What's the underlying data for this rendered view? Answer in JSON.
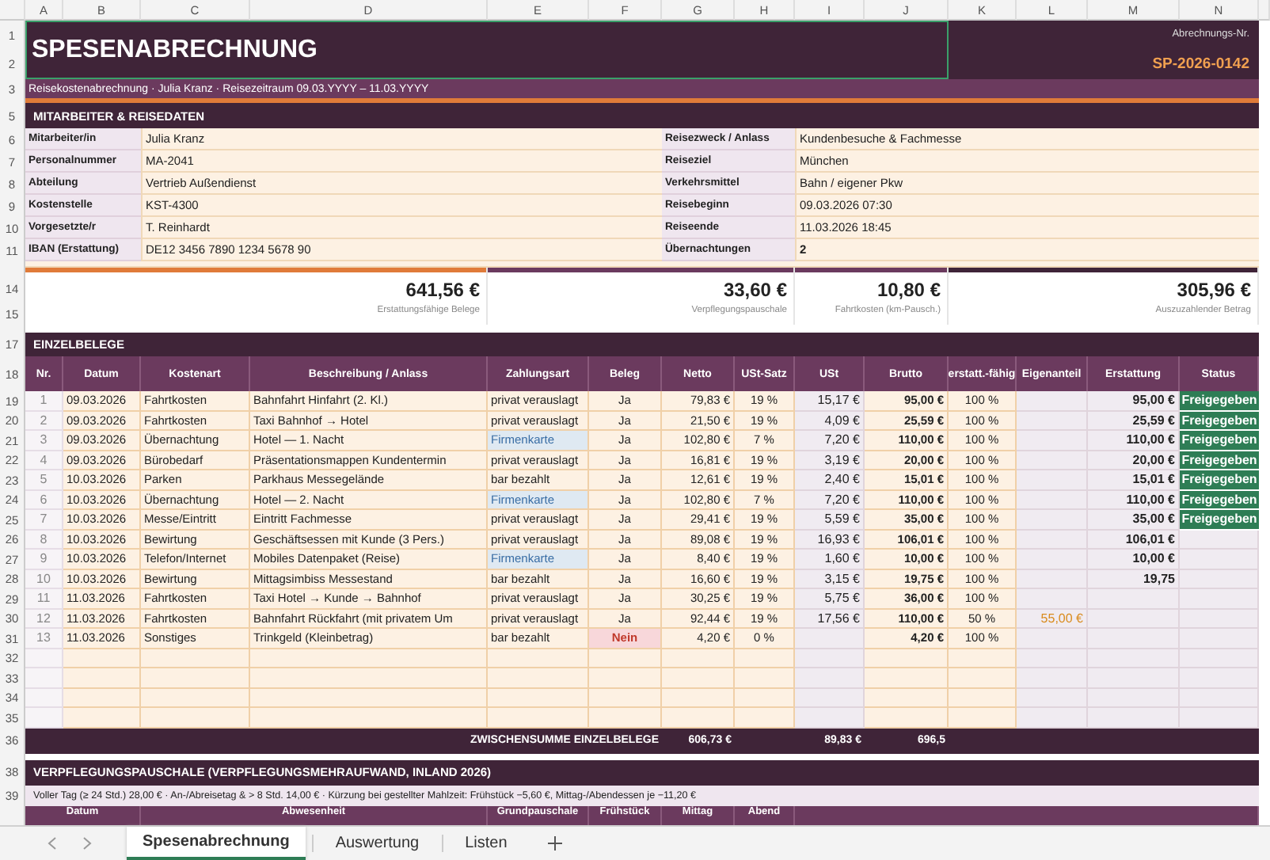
{
  "column_headers": [
    "A",
    "B",
    "C",
    "D",
    "E",
    "F",
    "G",
    "H",
    "I",
    "J",
    "K",
    "L",
    "M",
    "N"
  ],
  "row_numbers": [
    "1",
    "2",
    "3",
    "5",
    "6",
    "7",
    "8",
    "9",
    "10",
    "11",
    "14",
    "15",
    "17",
    "18",
    "19",
    "20",
    "21",
    "22",
    "23",
    "24",
    "25",
    "26",
    "27",
    "28",
    "29",
    "30",
    "31",
    "32",
    "33",
    "34",
    "35",
    "36",
    "38",
    "39"
  ],
  "title": {
    "text": "SPESENABRECHNUNG",
    "selected": true,
    "number_label": "Abrechnungs-Nr.",
    "number": "SP-2026-0142",
    "subtitle": "Reisekostenabrechnung · Julia Kranz · Reisezeitraum 09.03.YYYY – 11.03.YYYY"
  },
  "employee": {
    "heading": "MITARBEITER & REISEDATEN",
    "left": [
      {
        "label": "Mitarbeiter/in",
        "value": "Julia Kranz"
      },
      {
        "label": "Personalnummer",
        "value": "MA-2041"
      },
      {
        "label": "Abteilung",
        "value": "Vertrieb Außendienst"
      },
      {
        "label": "Kostenstelle",
        "value": "KST-4300"
      },
      {
        "label": "Vorgesetzte/r",
        "value": "T. Reinhardt"
      },
      {
        "label": "IBAN (Erstattung)",
        "value": "DE12 3456 7890 1234 5678 90"
      }
    ],
    "right": [
      {
        "label": "Reisezweck / Anlass",
        "value": "Kundenbesuche & Fachmesse"
      },
      {
        "label": "Reiseziel",
        "value": "München"
      },
      {
        "label": "Verkehrsmittel",
        "value": "Bahn / eigener Pkw"
      },
      {
        "label": "Reisebeginn",
        "value": "09.03.2026  07:30"
      },
      {
        "label": "Reiseende",
        "value": "11.03.2026  18:45"
      },
      {
        "label": "Übernachtungen",
        "value": "2"
      }
    ]
  },
  "summary": [
    {
      "value": "641,56 €",
      "label": "Erstattungsfähige Belege",
      "color": "#e07b39"
    },
    {
      "value": "33,60 €",
      "label": "Verpflegungspauschale",
      "color": "#6b3a5e"
    },
    {
      "value": "10,80 €",
      "label": "Fahrtkosten (km-Pausch.)",
      "color": "#6b3a5e"
    },
    {
      "value": "305,96 €",
      "label": "Auszuzahlender Betrag",
      "color": "#3f2438"
    }
  ],
  "expenses": {
    "heading": "EINZELBELEGE",
    "columns": [
      "Nr.",
      "Datum",
      "Kostenart",
      "Beschreibung / Anlass",
      "Zahlungsart",
      "Beleg",
      "Netto",
      "USt-Satz",
      "USt",
      "Brutto",
      "erstatt.-fähig",
      "Eigenanteil",
      "Erstattung",
      "Status"
    ],
    "rows": [
      {
        "nr": "1",
        "date": "09.03.2026",
        "type": "Fahrtkosten",
        "description": "Bahnfahrt Hinfahrt (2. Kl.)",
        "payment": "privat verauslagt",
        "company_card": false,
        "receipt": "Ja",
        "receipt_missing": false,
        "net": "79,83 €",
        "vat_rate": "19 %",
        "vat": "15,17 €",
        "gross": "95,00 €",
        "share": "100 %",
        "own": "",
        "refund": "95,00 €",
        "status": "Freigegeben"
      },
      {
        "nr": "2",
        "date": "09.03.2026",
        "type": "Fahrtkosten",
        "description": "Taxi Bahnhof → Hotel",
        "payment": "privat verauslagt",
        "company_card": false,
        "receipt": "Ja",
        "receipt_missing": false,
        "net": "21,50 €",
        "vat_rate": "19 %",
        "vat": "4,09 €",
        "gross": "25,59 €",
        "share": "100 %",
        "own": "",
        "refund": "25,59 €",
        "status": "Freigegeben"
      },
      {
        "nr": "3",
        "date": "09.03.2026",
        "type": "Übernachtung",
        "description": "Hotel — 1. Nacht",
        "payment": "Firmenkarte",
        "company_card": true,
        "receipt": "Ja",
        "receipt_missing": false,
        "net": "102,80 €",
        "vat_rate": "7 %",
        "vat": "7,20 €",
        "gross": "110,00 €",
        "share": "100 %",
        "own": "",
        "refund": "110,00 €",
        "status": "Freigegeben"
      },
      {
        "nr": "4",
        "date": "09.03.2026",
        "type": "Bürobedarf",
        "description": "Präsentationsmappen Kundentermin",
        "payment": "privat verauslagt",
        "company_card": false,
        "receipt": "Ja",
        "receipt_missing": false,
        "net": "16,81 €",
        "vat_rate": "19 %",
        "vat": "3,19 €",
        "gross": "20,00 €",
        "share": "100 %",
        "own": "",
        "refund": "20,00 €",
        "status": "Freigegeben"
      },
      {
        "nr": "5",
        "date": "10.03.2026",
        "type": "Parken",
        "description": "Parkhaus Messegelände",
        "payment": "bar bezahlt",
        "company_card": false,
        "receipt": "Ja",
        "receipt_missing": false,
        "net": "12,61 €",
        "vat_rate": "19 %",
        "vat": "2,40 €",
        "gross": "15,01 €",
        "share": "100 %",
        "own": "",
        "refund": "15,01 €",
        "status": "Freigegeben"
      },
      {
        "nr": "6",
        "date": "10.03.2026",
        "type": "Übernachtung",
        "description": "Hotel — 2. Nacht",
        "payment": "Firmenkarte",
        "company_card": true,
        "receipt": "Ja",
        "receipt_missing": false,
        "net": "102,80 €",
        "vat_rate": "7 %",
        "vat": "7,20 €",
        "gross": "110,00 €",
        "share": "100 %",
        "own": "",
        "refund": "110,00 €",
        "status": "Freigegeben"
      },
      {
        "nr": "7",
        "date": "10.03.2026",
        "type": "Messe/Eintritt",
        "description": "Eintritt Fachmesse",
        "payment": "privat verauslagt",
        "company_card": false,
        "receipt": "Ja",
        "receipt_missing": false,
        "net": "29,41 €",
        "vat_rate": "19 %",
        "vat": "5,59 €",
        "gross": "35,00 €",
        "share": "100 %",
        "own": "",
        "refund": "35,00 €",
        "status": "Freigegeben"
      },
      {
        "nr": "8",
        "date": "10.03.2026",
        "type": "Bewirtung",
        "description": "Geschäftsessen mit Kunde (3 Pers.)",
        "payment": "privat verauslagt",
        "company_card": false,
        "receipt": "Ja",
        "receipt_missing": false,
        "net": "89,08 €",
        "vat_rate": "19 %",
        "vat": "16,93 €",
        "gross": "106,01 €",
        "share": "100 %",
        "own": "",
        "refund": "106,01 €",
        "status": ""
      },
      {
        "nr": "9",
        "date": "10.03.2026",
        "type": "Telefon/Internet",
        "description": "Mobiles Datenpaket (Reise)",
        "payment": "Firmenkarte",
        "company_card": true,
        "receipt": "Ja",
        "receipt_missing": false,
        "net": "8,40 €",
        "vat_rate": "19 %",
        "vat": "1,60 €",
        "gross": "10,00 €",
        "share": "100 %",
        "own": "",
        "refund": "10,00 €",
        "status": ""
      },
      {
        "nr": "10",
        "date": "10.03.2026",
        "type": "Bewirtung",
        "description": "Mittagsimbiss Messestand",
        "payment": "bar bezahlt",
        "company_card": false,
        "receipt": "Ja",
        "receipt_missing": false,
        "net": "16,60 €",
        "vat_rate": "19 %",
        "vat": "3,15 €",
        "gross": "19,75 €",
        "share": "100 %",
        "own": "",
        "refund": "19,75",
        "status": ""
      },
      {
        "nr": "11",
        "date": "11.03.2026",
        "type": "Fahrtkosten",
        "description": "Taxi Hotel → Kunde → Bahnhof",
        "payment": "privat verauslagt",
        "company_card": false,
        "receipt": "Ja",
        "receipt_missing": false,
        "net": "30,25 €",
        "vat_rate": "19 %",
        "vat": "5,75 €",
        "gross": "36,00 €",
        "share": "100 %",
        "own": "",
        "refund": "",
        "status": ""
      },
      {
        "nr": "12",
        "date": "11.03.2026",
        "type": "Fahrtkosten",
        "description": "Bahnfahrt Rückfahrt (mit privatem Um",
        "payment": "privat verauslagt",
        "company_card": false,
        "receipt": "Ja",
        "receipt_missing": false,
        "net": "92,44 €",
        "vat_rate": "19 %",
        "vat": "17,56 €",
        "gross": "110,00 €",
        "share": "50 %",
        "own": "55,00 €",
        "refund": "",
        "status": ""
      },
      {
        "nr": "13",
        "date": "11.03.2026",
        "type": "Sonstiges",
        "description": "Trinkgeld (Kleinbetrag)",
        "payment": "bar bezahlt",
        "company_card": false,
        "receipt": "Nein",
        "receipt_missing": true,
        "net": "4,20 €",
        "vat_rate": "0 %",
        "vat": "",
        "gross": "4,20 €",
        "share": "100 %",
        "own": "",
        "refund": "",
        "status": ""
      }
    ],
    "subtotal": {
      "label": "ZWISCHENSUMME EINZELBELEGE",
      "net": "606,73 €",
      "vat": "89,83 €",
      "gross": "696,5"
    }
  },
  "meals": {
    "heading": "VERPFLEGUNGSPAUSCHALE (VERPFLEGUNGSMEHRAUFWAND, INLAND 2026)",
    "note": "Voller Tag (≥ 24 Std.) 28,00 € · An-/Abreisetag & > 8 Std. 14,00 € · Kürzung bei gestellter Mahlzeit: Frühstück −5,60 €, Mittag-/Abendessen je −11,20 €",
    "columns": [
      "Datum",
      "Abwesenheit",
      "Grundpauschale",
      "Frühstück",
      "Mittag",
      "Abend"
    ]
  },
  "sheet_tabs": [
    {
      "label": "Spesenabrechnung",
      "selected": true
    },
    {
      "label": "Auswertung",
      "selected": false
    },
    {
      "label": "Listen",
      "selected": false
    }
  ]
}
